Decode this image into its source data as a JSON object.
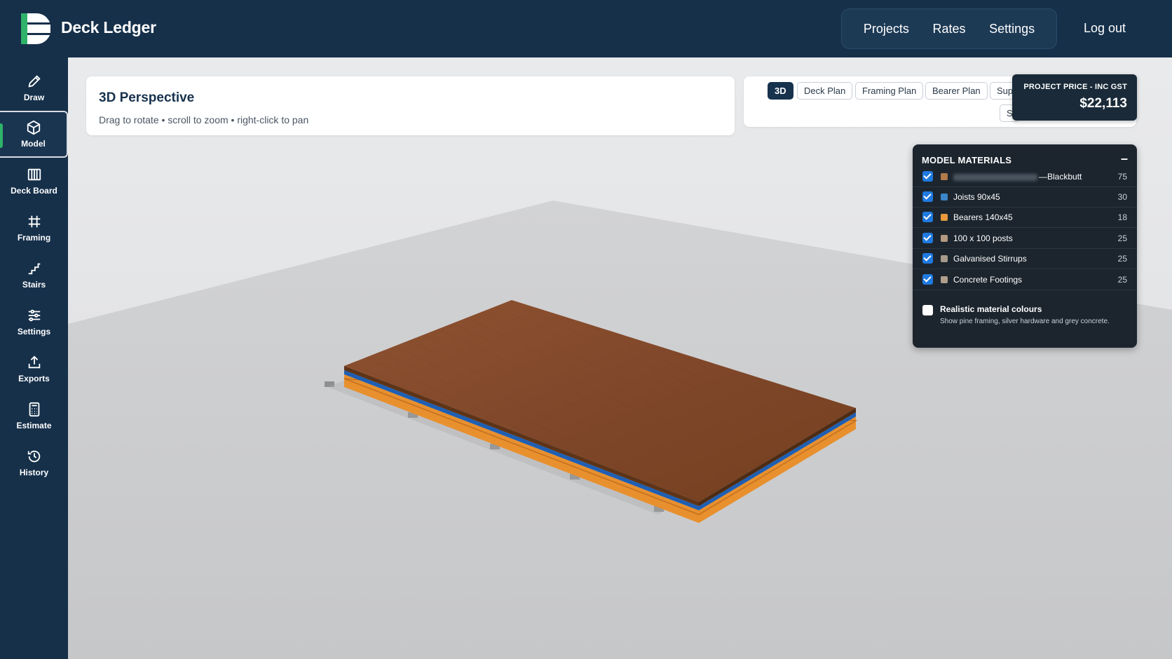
{
  "app": {
    "name": "Deck Ledger"
  },
  "top_nav": {
    "items": [
      "Projects",
      "Rates",
      "Settings"
    ],
    "logout": "Log out"
  },
  "sidebar": {
    "items": [
      {
        "label": "Draw",
        "icon": "pencil-icon"
      },
      {
        "label": "Model",
        "icon": "cube-icon",
        "active": true
      },
      {
        "label": "Deck Board",
        "icon": "deck-board-icon"
      },
      {
        "label": "Framing",
        "icon": "grid-icon"
      },
      {
        "label": "Stairs",
        "icon": "stairs-icon"
      },
      {
        "label": "Settings",
        "icon": "sliders-icon"
      },
      {
        "label": "Exports",
        "icon": "upload-icon"
      },
      {
        "label": "Estimate",
        "icon": "calculator-icon"
      },
      {
        "label": "History",
        "icon": "history-icon"
      }
    ]
  },
  "view": {
    "title": "3D Perspective",
    "hint": "Drag to rotate • scroll to zoom • right-click to pan",
    "tabs": [
      "3D",
      "Deck Plan",
      "Framing Plan",
      "Bearer Plan",
      "Sup",
      "S"
    ],
    "active_tab": "3D"
  },
  "price": {
    "label": "PROJECT PRICE - INC GST",
    "value": "$22,113"
  },
  "materials": {
    "title": "MODEL MATERIALS",
    "collapse": "–",
    "rows": [
      {
        "name": "—Blackbutt",
        "qty": "75",
        "color": "#b07a4a",
        "checked": true,
        "blurred_prefix": true
      },
      {
        "name": "Joists 90x45",
        "qty": "30",
        "color": "#3a86c8",
        "checked": true
      },
      {
        "name": "Bearers 140x45",
        "qty": "18",
        "color": "#e89a3c",
        "checked": true
      },
      {
        "name": "100 x 100 posts",
        "qty": "25",
        "color": "#b39a80",
        "checked": true
      },
      {
        "name": "Galvanised Stirrups",
        "qty": "25",
        "color": "#a89a8a",
        "checked": true
      },
      {
        "name": "Concrete Footings",
        "qty": "25",
        "color": "#b09e8c",
        "checked": true
      }
    ],
    "realistic_toggle": {
      "label": "Realistic material colours",
      "description": "Show pine framing, silver hardware and grey concrete.",
      "checked": false
    }
  },
  "colors": {
    "nav_bg": "#16304a",
    "accent_green": "#2fb36b",
    "deck_wood": "#8b4a26",
    "joist_blue": "#1f5fb3",
    "bearer_orange": "#e8902e"
  }
}
